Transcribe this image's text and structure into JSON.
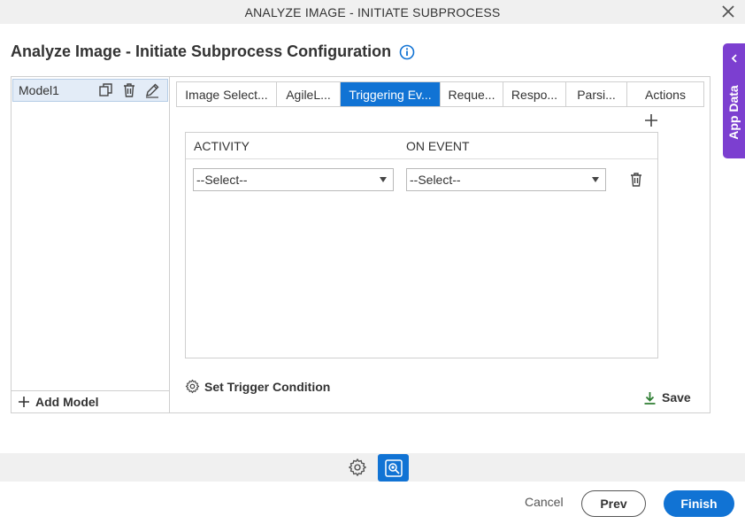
{
  "window": {
    "title": "ANALYZE IMAGE - INITIATE SUBPROCESS"
  },
  "header": {
    "title": "Analyze Image - Initiate Subprocess Configuration"
  },
  "app_data": {
    "label": "App Data"
  },
  "models": {
    "items": [
      {
        "label": "Model1"
      }
    ],
    "add_label": "Add Model"
  },
  "tabs": [
    {
      "label": "Image Select..."
    },
    {
      "label": "AgileL..."
    },
    {
      "label": "Triggering Ev...",
      "active": true
    },
    {
      "label": "Reque..."
    },
    {
      "label": "Respo..."
    },
    {
      "label": "Parsi..."
    },
    {
      "label": "Actions"
    }
  ],
  "grid": {
    "columns": [
      "ACTIVITY",
      "ON EVENT"
    ],
    "rows": [
      {
        "activity": "--Select--",
        "on_event": "--Select--"
      }
    ]
  },
  "set_trigger_label": "Set Trigger Condition",
  "save_label": "Save",
  "footer": {
    "cancel": "Cancel",
    "prev": "Prev",
    "finish": "Finish"
  },
  "colors": {
    "accent": "#1173d4",
    "app_data": "#7c3fd0",
    "save_icon": "#2e7d32"
  }
}
